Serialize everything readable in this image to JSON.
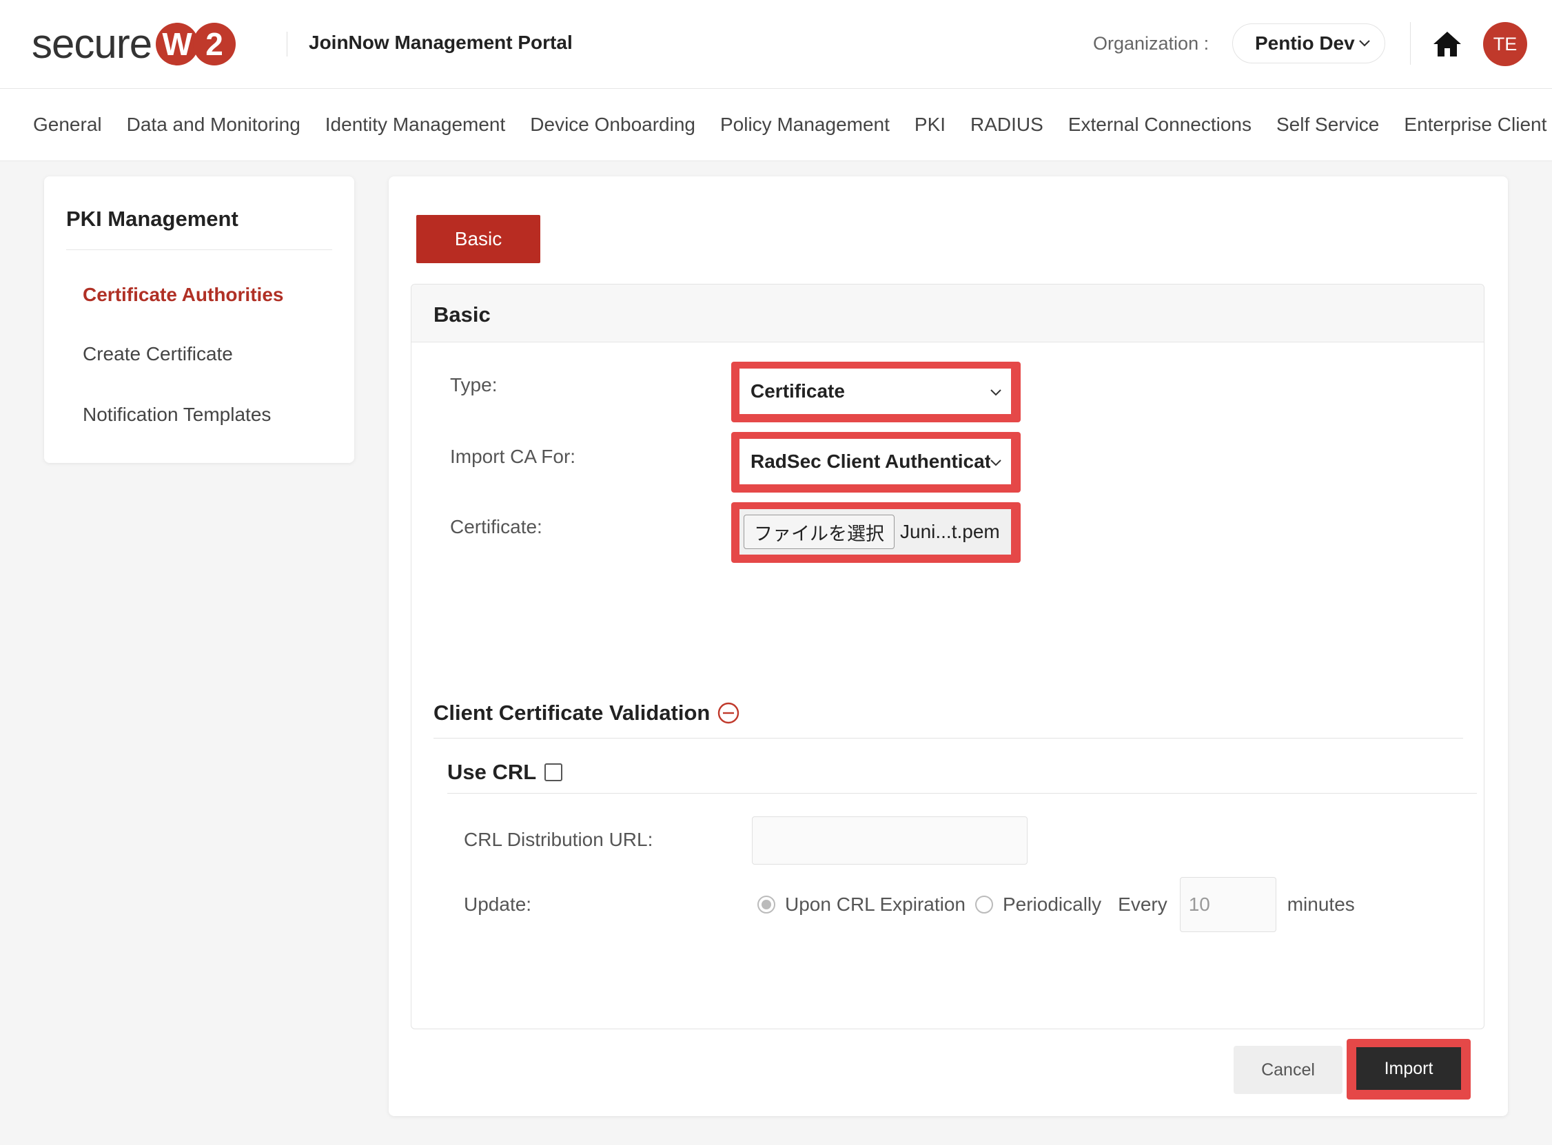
{
  "brand": {
    "logo_text": "secure",
    "logo_w": "W",
    "logo_2": "2",
    "portal_title": "JoinNow Management Portal",
    "accent_color": "#c0392b"
  },
  "header": {
    "org_label": "Organization :",
    "org_value": "Pentio Dev",
    "avatar_initials": "TE",
    "home_icon": "home-icon"
  },
  "nav": {
    "items": [
      "General",
      "Data and Monitoring",
      "Identity Management",
      "Device Onboarding",
      "Policy Management",
      "PKI",
      "RADIUS",
      "External Connections",
      "Self Service",
      "Enterprise Client"
    ]
  },
  "sidebar": {
    "title": "PKI Management",
    "items": [
      "Certificate Authorities",
      "Create Certificate",
      "Notification Templates"
    ],
    "active_index": 0
  },
  "main": {
    "tab_label": "Basic",
    "panel_title": "Basic",
    "type_label": "Type:",
    "type_value": "Certificate",
    "import_for_label": "Import CA For:",
    "import_for_value": "RadSec Client Authentication",
    "certificate_label": "Certificate:",
    "file_button_label": "ファイルを選択",
    "file_name": "Juni...t.pem",
    "section_title": "Client Certificate Validation",
    "use_crl_label": "Use CRL",
    "crl_url_label": "CRL Distribution URL:",
    "crl_url_value": "",
    "update_label": "Update:",
    "update_options": [
      "Upon CRL Expiration",
      "Periodically"
    ],
    "update_selected": "Upon CRL Expiration",
    "every_label": "Every",
    "every_value": "10",
    "minutes_label": "minutes",
    "cancel_label": "Cancel",
    "import_label": "Import"
  }
}
